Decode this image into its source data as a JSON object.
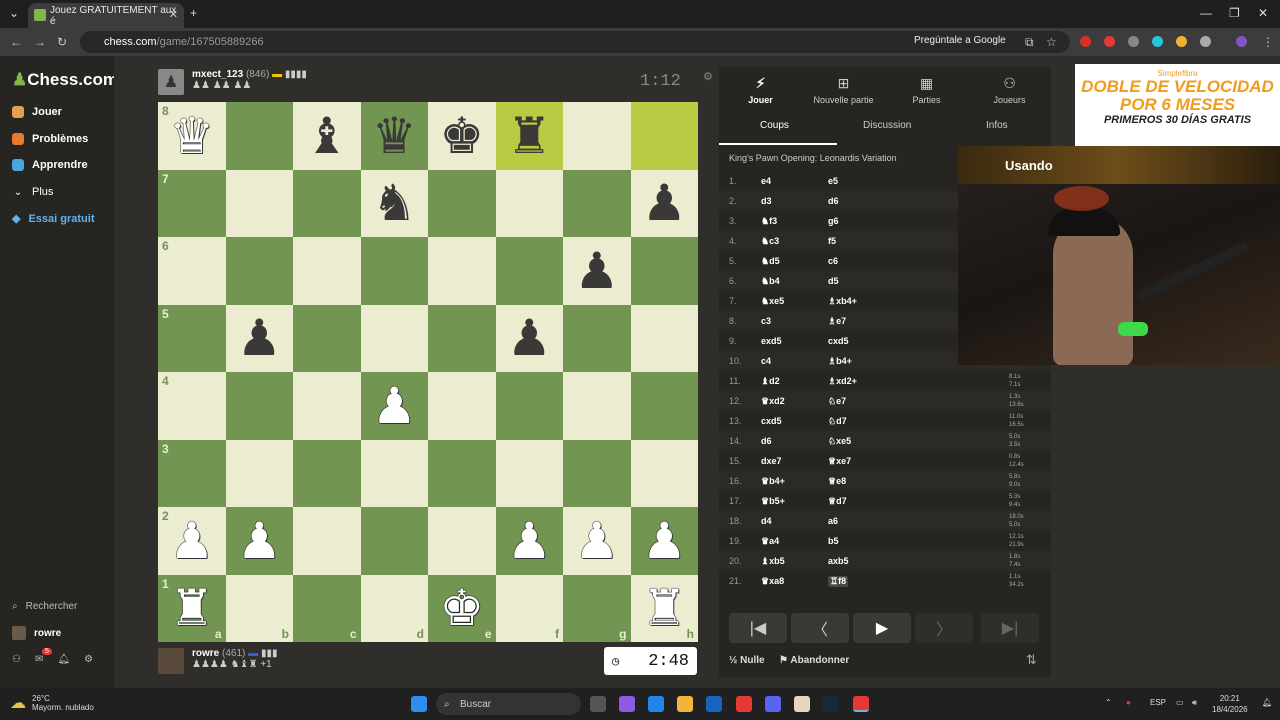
{
  "browser": {
    "tab_title": "Jouez GRATUITEMENT aux é",
    "url_host": "chess.com",
    "url_path": "/game/167505889266",
    "ask_google": "Pregúntale a Google"
  },
  "sidebar": {
    "logo_text": "Chess.com",
    "items": [
      {
        "label": "Jouer",
        "icon": "play-icon",
        "color": "#e0a04a"
      },
      {
        "label": "Problèmes",
        "icon": "puzzle-icon",
        "color": "#e87a2a"
      },
      {
        "label": "Apprendre",
        "icon": "learn-icon",
        "color": "#4aa4e0"
      },
      {
        "label": "Plus",
        "icon": "chevron-down-icon",
        "color": "#cccccc"
      },
      {
        "label": "Essai gratuit",
        "icon": "diamond-icon",
        "color": "#5fb3f2"
      }
    ],
    "search_label": "Rechercher",
    "user_label": "rowre",
    "notification_count": "5"
  },
  "game": {
    "top_player": {
      "name": "mxect_123",
      "rating": "(846)",
      "clock": "1:12"
    },
    "bottom_player": {
      "name": "rowre",
      "rating": "(461)",
      "clock": "2:48",
      "material_diff": "+1"
    },
    "board": [
      [
        "wQ",
        "",
        "bB",
        "bQ",
        "bK",
        "bR",
        "",
        ""
      ],
      [
        "",
        "",
        "",
        "bN",
        "",
        "",
        "",
        "bP"
      ],
      [
        "",
        "",
        "",
        "",
        "",
        "",
        "bP",
        ""
      ],
      [
        "",
        "bP",
        "",
        "",
        "",
        "bP",
        "",
        ""
      ],
      [
        "",
        "",
        "",
        "wP",
        "",
        "",
        "",
        ""
      ],
      [
        "",
        "",
        "",
        "",
        "",
        "",
        "",
        ""
      ],
      [
        "wP",
        "wP",
        "",
        "",
        "",
        "wP",
        "wP",
        "wP"
      ],
      [
        "wR",
        "",
        "",
        "",
        "wK",
        "",
        "",
        "wR"
      ]
    ],
    "highlight": [
      [
        0,
        5
      ],
      [
        0,
        7
      ]
    ],
    "files": [
      "a",
      "b",
      "c",
      "d",
      "e",
      "f",
      "g",
      "h"
    ],
    "ranks": [
      "8",
      "7",
      "6",
      "5",
      "4",
      "3",
      "2",
      "1"
    ]
  },
  "panel": {
    "tabs": [
      {
        "label": "Jouer",
        "icon": "bolt-icon",
        "active": true
      },
      {
        "label": "Nouvelle partie",
        "icon": "plus-icon",
        "active": false
      },
      {
        "label": "Parties",
        "icon": "board-icon",
        "active": false
      },
      {
        "label": "Joueurs",
        "icon": "players-icon",
        "active": false
      }
    ],
    "subtabs": [
      "Coups",
      "Discussion",
      "Infos"
    ],
    "opening": "King's Pawn Opening: Leonardis Variation",
    "moves": [
      {
        "n": "1.",
        "w": "e4",
        "b": "e5",
        "tw": "",
        "tb": ""
      },
      {
        "n": "2.",
        "w": "d3",
        "b": "d6",
        "tw": "",
        "tb": ""
      },
      {
        "n": "3.",
        "w": "♞f3",
        "b": "g6",
        "tw": "",
        "tb": ""
      },
      {
        "n": "4.",
        "w": "♞c3",
        "b": "f5",
        "tw": "",
        "tb": ""
      },
      {
        "n": "5.",
        "w": "♞d5",
        "b": "c6",
        "tw": "",
        "tb": ""
      },
      {
        "n": "6.",
        "w": "♞b4",
        "b": "d5",
        "tw": "",
        "tb": ""
      },
      {
        "n": "7.",
        "w": "♞xe5",
        "b": "♗xb4+",
        "tw": "",
        "tb": ""
      },
      {
        "n": "8.",
        "w": "c3",
        "b": "♗e7",
        "tw": "",
        "tb": ""
      },
      {
        "n": "9.",
        "w": "exd5",
        "b": "cxd5",
        "tw": "",
        "tb": ""
      },
      {
        "n": "10.",
        "w": "c4",
        "b": "♗b4+",
        "tw": "",
        "tb": ""
      },
      {
        "n": "11.",
        "w": "♝d2",
        "b": "♗xd2+",
        "tw": "8.1s",
        "tb": "7.1s"
      },
      {
        "n": "12.",
        "w": "♛xd2",
        "b": "♘e7",
        "tw": "1.3s",
        "tb": "13.6s"
      },
      {
        "n": "13.",
        "w": "cxd5",
        "b": "♘d7",
        "tw": "11.0s",
        "tb": "16.5s"
      },
      {
        "n": "14.",
        "w": "d6",
        "b": "♘xe5",
        "tw": "5.0s",
        "tb": "3.5s"
      },
      {
        "n": "15.",
        "w": "dxe7",
        "b": "♕xe7",
        "tw": "0.8s",
        "tb": "12.4s"
      },
      {
        "n": "16.",
        "w": "♛b4+",
        "b": "♕e8",
        "tw": "5.8s",
        "tb": "9.0s"
      },
      {
        "n": "17.",
        "w": "♛b5+",
        "b": "♕d7",
        "tw": "5.3s",
        "tb": "9.4s"
      },
      {
        "n": "18.",
        "w": "d4",
        "b": "a6",
        "tw": "18.0s",
        "tb": "5.0s"
      },
      {
        "n": "19.",
        "w": "♛a4",
        "b": "b5",
        "tw": "12.1s",
        "tb": "21.9s"
      },
      {
        "n": "20.",
        "w": "♝xb5",
        "b": "axb5",
        "tw": "1.8s",
        "tb": "7.4s"
      },
      {
        "n": "21.",
        "w": "♛xa8",
        "b": "♖f8",
        "tw": "1.1s",
        "tb": "34.2s"
      }
    ],
    "draw_label": "Nulle",
    "resign_label": "Abandonner"
  },
  "ad": {
    "brand": "Simplefibra",
    "line1": "DOBLE DE VELOCIDAD",
    "line2": "POR 6 MESES",
    "line3": "PRIMEROS 30 DÍAS GRATIS"
  },
  "webcam": {
    "banner_text": "Usando"
  },
  "taskbar": {
    "temperature": "26°C",
    "weather": "Mayorm. nublado",
    "search_label": "Buscar",
    "lang": "ESP",
    "time": "20:21",
    "date": "18/4/2026"
  }
}
